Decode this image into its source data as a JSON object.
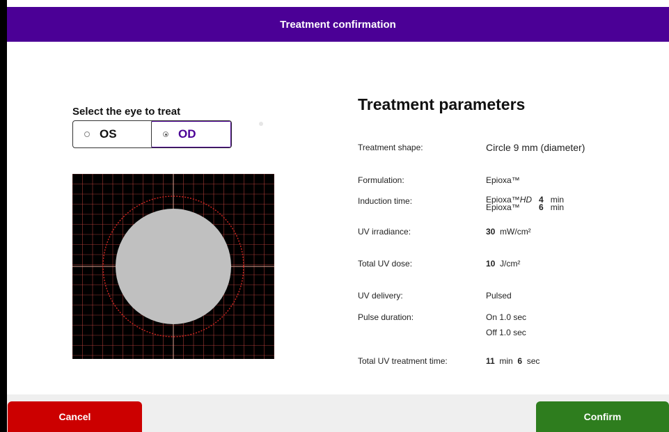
{
  "header": {
    "title": "Treatment confirmation"
  },
  "eye_select": {
    "label": "Select the eye to treat",
    "options": [
      {
        "label": "OS",
        "selected": false
      },
      {
        "label": "OD",
        "selected": true
      }
    ]
  },
  "params": {
    "title": "Treatment parameters",
    "shape_label": "Treatment shape:",
    "shape_value": "Circle 9 mm (diameter)",
    "formulation_label": "Formulation:",
    "formulation_value": "Epioxa™",
    "induction_label": "Induction time:",
    "induction": [
      {
        "name_plain": "Epioxa™",
        "name_italic": "HD",
        "value": "4",
        "unit": "min"
      },
      {
        "name_plain": "Epioxa™",
        "name_italic": "",
        "value": "6",
        "unit": "min"
      }
    ],
    "irradiance_label": "UV irradiance:",
    "irradiance_value": "30",
    "irradiance_unit": "mW/cm²",
    "dose_label": "Total UV dose:",
    "dose_value": "10",
    "dose_unit": "J/cm²",
    "delivery_label": "UV delivery:",
    "delivery_value": "Pulsed",
    "pulse_label": "Pulse duration:",
    "pulse_on": "On 1.0 sec",
    "pulse_off": "Off 1.0 sec",
    "total_time_label": "Total UV treatment time:",
    "total_time_min": "11",
    "total_time_min_unit": "min",
    "total_time_sec": "6",
    "total_time_sec_unit": "sec"
  },
  "buttons": {
    "cancel": "Cancel",
    "confirm": "Confirm"
  },
  "colors": {
    "header": "#4b0096",
    "cancel": "#cc0000",
    "confirm": "#2e7d1e",
    "grid": "#c0453f",
    "spot": "#c0c0c0"
  }
}
